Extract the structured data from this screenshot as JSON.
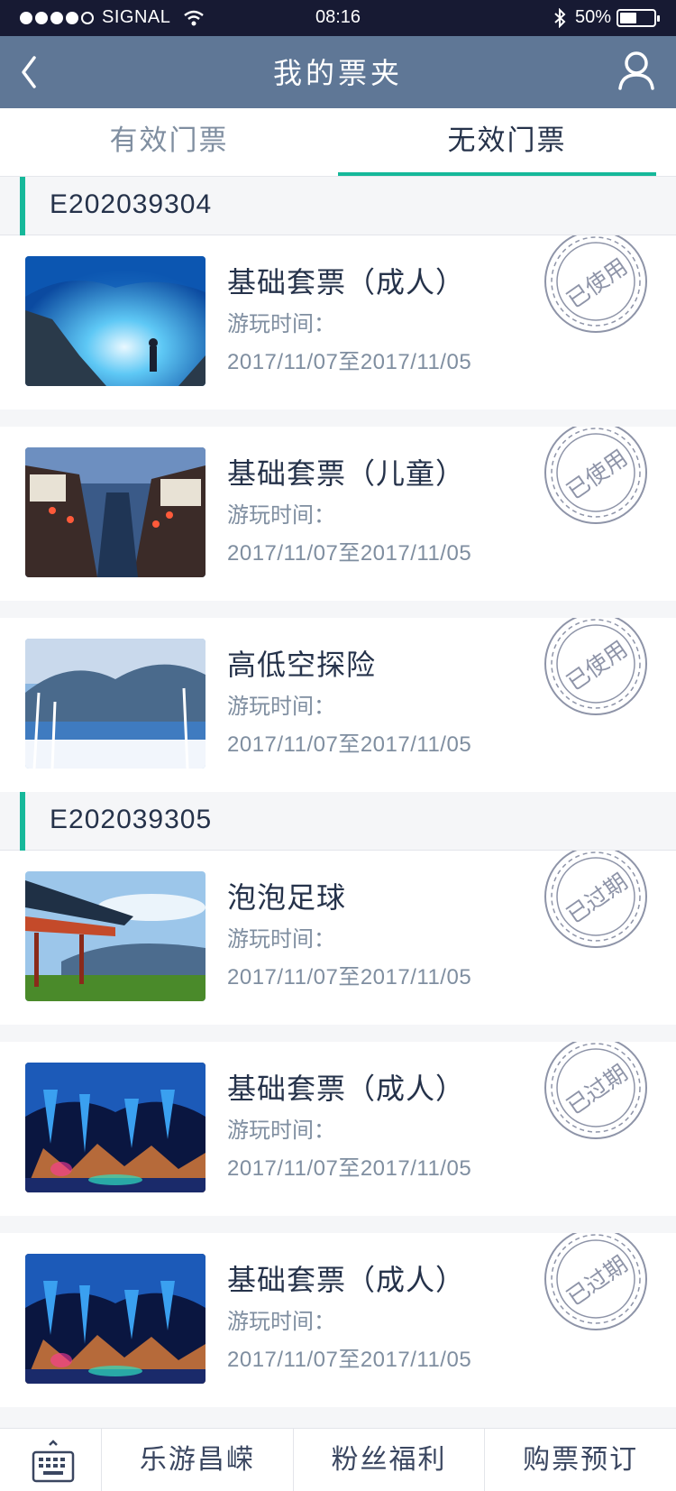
{
  "status_bar": {
    "carrier": "SIGNAL",
    "time": "08:16",
    "battery": "50%",
    "battery_level": 0.5
  },
  "header": {
    "title": "我的票夹",
    "back_icon": "chevron-left-icon",
    "user_icon": "user-icon"
  },
  "tabs": [
    {
      "label": "有效门票",
      "active": false
    },
    {
      "label": "无效门票",
      "active": true
    }
  ],
  "groups": [
    {
      "order_no": "E202039304",
      "tickets": [
        {
          "name": "基础套票（成人）",
          "label": "游玩时间：",
          "date": "2017/11/07至2017/11/05",
          "stamp": "已使用",
          "image": "ice-cave"
        },
        {
          "name": "基础套票（儿童）",
          "label": "游玩时间：",
          "date": "2017/11/07至2017/11/05",
          "stamp": "已使用",
          "image": "water-town"
        },
        {
          "name": "高低空探险",
          "label": "游玩时间：",
          "date": "2017/11/07至2017/11/05",
          "stamp": "已使用",
          "image": "snow-lake"
        }
      ]
    },
    {
      "order_no": "E202039305",
      "tickets": [
        {
          "name": "泡泡足球",
          "label": "游玩时间：",
          "date": "2017/11/07至2017/11/05",
          "stamp": "已过期",
          "image": "pavilion"
        },
        {
          "name": "基础套票（成人）",
          "label": "游玩时间：",
          "date": "2017/11/07至2017/11/05",
          "stamp": "已过期",
          "image": "karst-cave"
        },
        {
          "name": "基础套票（成人）",
          "label": "游玩时间：",
          "date": "2017/11/07至2017/11/05",
          "stamp": "已过期",
          "image": "karst-cave"
        }
      ]
    }
  ],
  "bottom_nav": {
    "keyboard_icon": "keyboard-icon",
    "items": [
      "乐游昌嵘",
      "粉丝福利",
      "购票预订"
    ]
  },
  "colors": {
    "header_bg": "#5f7796",
    "status_bg": "#171a33",
    "accent": "#16b89a",
    "title_text": "#25324a",
    "secondary_text": "#7f8ea0",
    "stamp": "#8e94a8"
  }
}
